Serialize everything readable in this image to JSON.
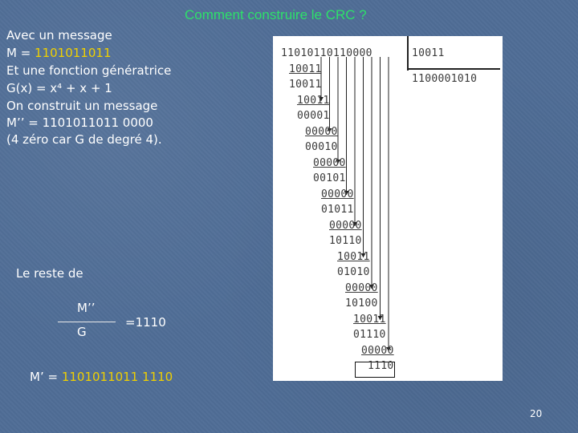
{
  "slide": {
    "title": "Comment construire le CRC ?",
    "lines": [
      {
        "id": "l1",
        "text": "Avec un message"
      },
      {
        "id": "l2",
        "prefix": "M = ",
        "value": "1101011011"
      },
      {
        "id": "l3",
        "text": "Et une fonction génératrice"
      },
      {
        "id": "l4",
        "text": "G(x) = x⁴ + x + 1"
      },
      {
        "id": "l5",
        "text": "On construit un message"
      },
      {
        "id": "l6",
        "text": "M’’ = 1101011011 0000"
      },
      {
        "id": "l7",
        "text": "(4 zéro car G de degré 4)."
      }
    ],
    "remainder_label": "Le reste de",
    "fraction": {
      "numerator": "M’’",
      "denominator": "G",
      "result": "=1110"
    },
    "mprime": {
      "prefix": "M’ = ",
      "message": "1101011011",
      "crc": "1110"
    },
    "page_number": "20"
  },
  "division": {
    "dividend": "11010110110000",
    "divisor": "10011",
    "quotient": "1100001010",
    "rows": [
      "11010110110000",
      "10011",
      "10011",
      "10011",
      "00001",
      "00000",
      "00010",
      "00000",
      "00101",
      "00000",
      "01011",
      "00000",
      "10110",
      "10011",
      "01010",
      "00000",
      "10100",
      "10011",
      "01110",
      "00000",
      "1110"
    ]
  }
}
